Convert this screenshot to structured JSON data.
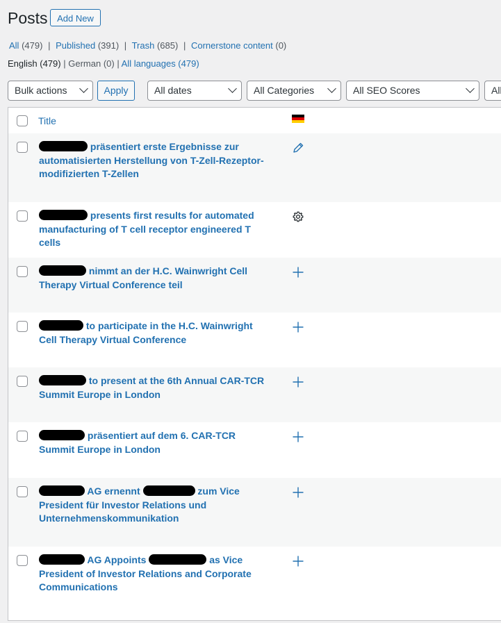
{
  "header": {
    "title": "Posts",
    "add_new": "Add New"
  },
  "views": [
    {
      "label": "All",
      "count": "(479)"
    },
    {
      "label": "Published",
      "count": "(391)"
    },
    {
      "label": "Trash",
      "count": "(685)"
    },
    {
      "label": "Cornerstone content",
      "count": "(0)"
    }
  ],
  "languages": {
    "english": "English (479)",
    "german": "German (0)",
    "all": "All languages (479)"
  },
  "filters": {
    "bulk_actions": "Bulk actions",
    "apply": "Apply",
    "dates": "All dates",
    "categories": "All Categories",
    "seo": "All SEO Scores",
    "more": "All"
  },
  "table": {
    "col_title": "Title",
    "flag_colors": [
      "#000000",
      "#dd0000",
      "#ffce00"
    ],
    "rows": [
      {
        "before": "",
        "after": "präsentiert erste Ergebnisse zur automatisierten Herstellung von T-Zell-Rezeptor-modifizierten T-Zellen",
        "icon": "pencil-icon"
      },
      {
        "before": "",
        "after": "presents first results for automated manufacturing of T cell receptor engineered T cells",
        "icon": "gear-icon"
      },
      {
        "before": "",
        "after": "nimmt an der H.C. Wainwright Cell Therapy Virtual Conference teil",
        "icon": "plus-icon"
      },
      {
        "before": "",
        "after": "to participate in the H.C. Wainwright Cell Therapy Virtual Conference",
        "icon": "plus-icon"
      },
      {
        "before": "",
        "after": "to present at the 6th Annual CAR-TCR Summit Europe in London",
        "icon": "plus-icon"
      },
      {
        "before": "",
        "after": "präsentiert auf dem 6. CAR-TCR Summit Europe in London",
        "icon": "plus-icon"
      },
      {
        "before": "AG ernennt",
        "after": "zum Vice President für Investor Relations und Unternehmenskommunikation",
        "icon": "plus-icon"
      },
      {
        "before": "AG Appoints",
        "after": "as Vice President of Investor Relations and Corporate Communications",
        "icon": "plus-icon"
      }
    ]
  }
}
